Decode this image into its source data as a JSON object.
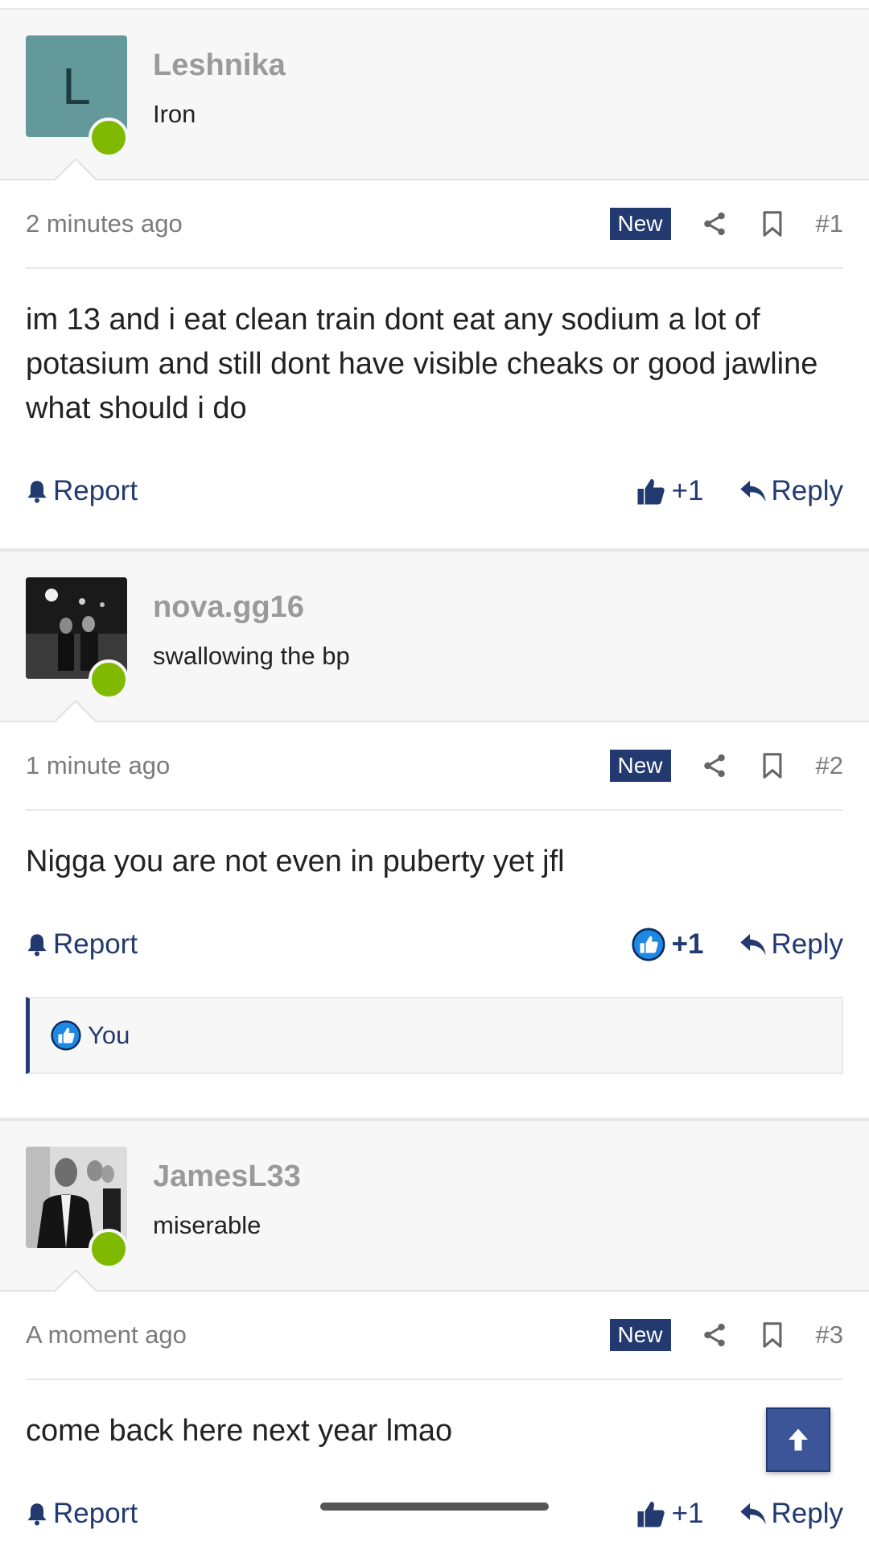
{
  "posts": [
    {
      "username": "Leshnika",
      "user_title": "Iron",
      "avatar_letter": "L",
      "timestamp": "2 minutes ago",
      "badge": "New",
      "post_number": "#1",
      "content": "im 13 and i eat clean train dont eat any sodium a lot of potasium and still dont have visible cheaks or good jawline what should i do",
      "report_label": "Report",
      "like_count": "+1",
      "reply_label": "Reply"
    },
    {
      "username": "nova.gg16",
      "user_title": "swallowing the bp",
      "timestamp": "1 minute ago",
      "badge": "New",
      "post_number": "#2",
      "content": "Nigga you are not even in puberty yet jfl",
      "report_label": "Report",
      "like_count": "+1",
      "reply_label": "Reply",
      "reaction_user": "You"
    },
    {
      "username": "JamesL33",
      "user_title": "miserable",
      "timestamp": "A moment ago",
      "badge": "New",
      "post_number": "#3",
      "content": "come back here next year lmao",
      "report_label": "Report",
      "like_count": "+1",
      "reply_label": "Reply"
    }
  ],
  "colors": {
    "accent": "#223a70",
    "online": "#7fba00",
    "like_active": "#1e88e5"
  },
  "icons": [
    "share-icon",
    "bookmark-icon",
    "bell-icon",
    "thumbs-up-icon",
    "reply-icon",
    "arrow-up-icon"
  ]
}
